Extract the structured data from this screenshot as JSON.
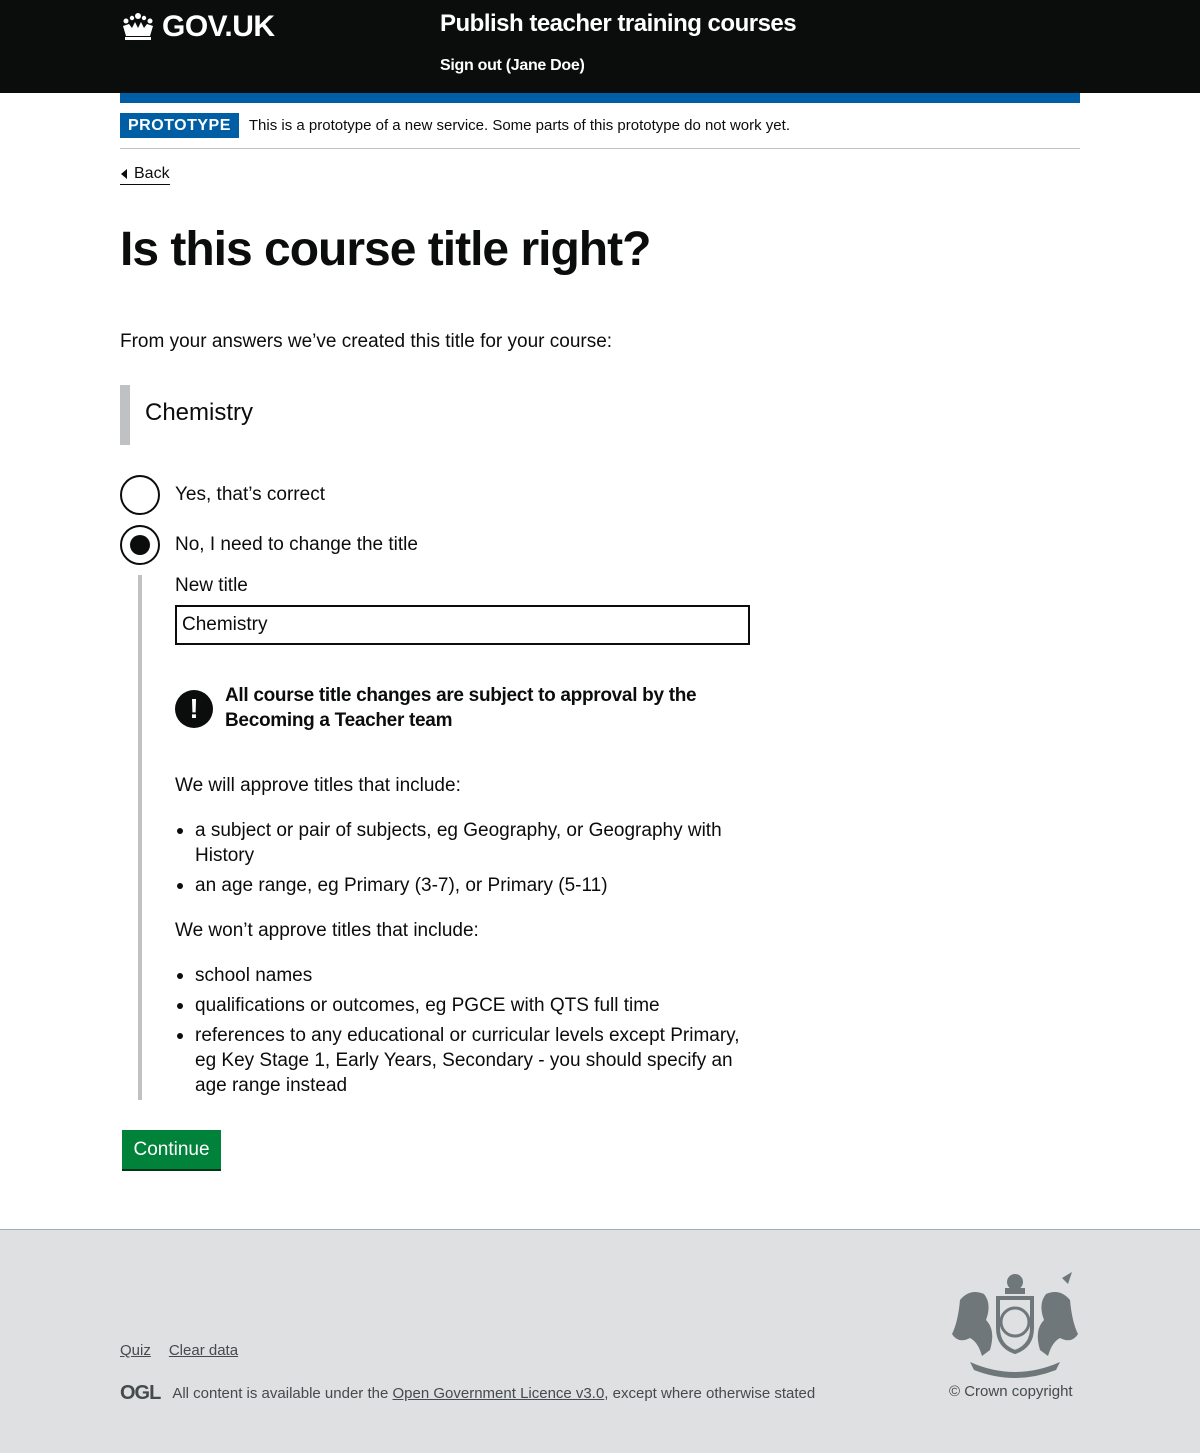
{
  "header": {
    "logo_text": "GOV.UK",
    "service_name": "Publish teacher training courses",
    "sign_out": "Sign out (Jane Doe)"
  },
  "phase": {
    "tag": "PROTOTYPE",
    "text": "This is a prototype of a new service. Some parts of this prototype do not work yet."
  },
  "back_link": "Back",
  "page_title": "Is this course title right?",
  "intro": "From your answers we’ve created this title for your course:",
  "generated_title": "Chemistry",
  "radios": [
    {
      "label": "Yes, that’s correct",
      "checked": false
    },
    {
      "label": "No, I need to change the title",
      "checked": true
    }
  ],
  "new_title": {
    "label": "New title",
    "value": "Chemistry"
  },
  "warning": {
    "icon": "!",
    "text": "All course title changes are subject to approval by the Becoming a Teacher team"
  },
  "approve": {
    "heading": "We will approve titles that include:",
    "items": [
      "a subject or pair of subjects, eg Geography, or Geography with History",
      "an age range, eg Primary (3-7), or Primary (5-11)"
    ]
  },
  "reject": {
    "heading": "We won’t approve titles that include:",
    "items": [
      "school names",
      "qualifications or outcomes, eg PGCE with QTS full time",
      "references to any educational or curricular levels except Primary, eg Key Stage 1, Early Years, Secondary - you should specify an age range instead"
    ]
  },
  "continue_label": "Continue",
  "footer": {
    "links": [
      "Quiz",
      "Clear data"
    ],
    "ogl_logo": "OGL",
    "licence_prefix": "All content is available under the",
    "licence_link": "Open Government Licence v3.0",
    "licence_suffix": ", except where otherwise stated",
    "copyright": "© Crown copyright"
  },
  "colors": {
    "header_bg": "#0b0c0c",
    "brand_blue": "#005ea5",
    "button_green": "#00823b",
    "footer_bg": "#dee0e2"
  }
}
